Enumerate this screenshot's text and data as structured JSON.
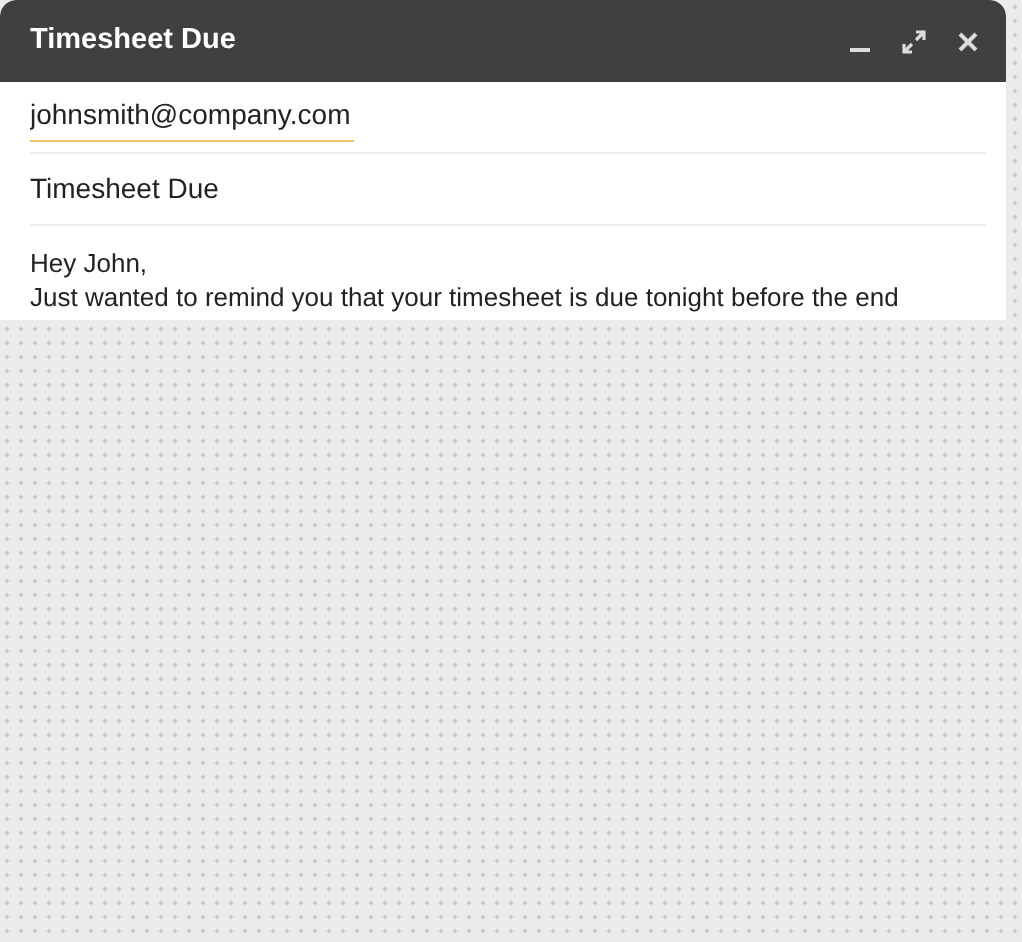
{
  "window": {
    "title": "Timesheet Due"
  },
  "to": {
    "value": "johnsmith@company.com"
  },
  "subject": {
    "value": "Timesheet Due"
  },
  "body": [
    "Hey John,",
    "Just wanted to remind you that your timesheet is due tonight before the end"
  ]
}
